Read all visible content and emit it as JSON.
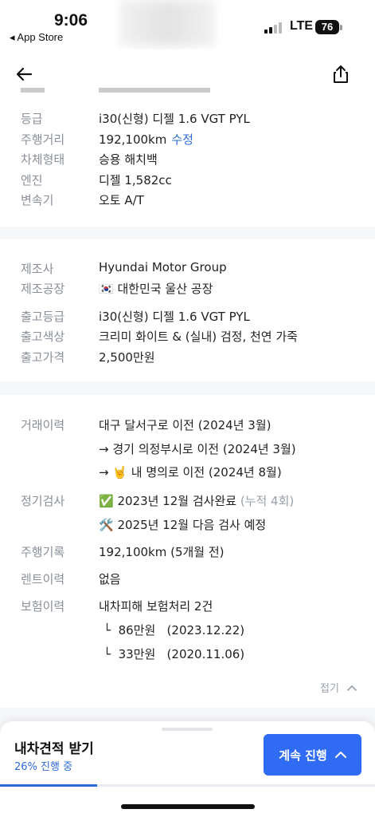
{
  "status_bar": {
    "time": "9:06",
    "back_app": "◂ App Store",
    "network": "LTE",
    "battery": "76"
  },
  "spec": {
    "rows": [
      {
        "label": "등급",
        "value": "i30(신형) 디젤 1.6 VGT PYL"
      },
      {
        "label": "주행거리",
        "value": "192,100km",
        "link": "수정"
      },
      {
        "label": "차체형태",
        "value": "승용 해치백"
      },
      {
        "label": "엔진",
        "value": "디젤 1,582cc"
      },
      {
        "label": "변속기",
        "value": "오토 A/T"
      }
    ]
  },
  "factory": {
    "rows": [
      {
        "label": "제조사",
        "value": "Hyundai Motor Group"
      },
      {
        "label": "제조공장",
        "value": "🇰🇷 대한민국 울산 공장"
      },
      {
        "label": "출고등급",
        "value": "i30(신형) 디젤 1.6 VGT PYL"
      },
      {
        "label": "출고색상",
        "value": "크리미 화이트 & (실내) 검정, 천연 가죽"
      },
      {
        "label": "출고가격",
        "value": "2,500만원"
      }
    ]
  },
  "history": {
    "trade_label": "거래이력",
    "trade_lines": [
      "대구 달서구로 이전 (2024년 3월)",
      "→ 경기 의정부시로 이전 (2024년 3월)",
      "→ 🤘 내 명의로 이전 (2024년 8월)"
    ],
    "inspection_label": "정기검사",
    "inspection_line1": "✅ 2023년 12월 검사완료",
    "inspection_count": "(누적 4회)",
    "inspection_line2": "🛠️ 2025년 12월 다음 검사 예정",
    "mileage_label": "주행기록",
    "mileage_value": "192,100km (5개월 전)",
    "rent_label": "렌트이력",
    "rent_value": "없음",
    "insurance_label": "보험이력",
    "insurance_value": "내차피해 보험처리 2건",
    "insurance_items": [
      "└  86만원   (2023.12.22)",
      "└  33만원   (2020.11.06)"
    ],
    "collapse_label": "접기"
  },
  "bottom_panel": {
    "title": "내차견적 받기",
    "progress_text": "26% 진행 중",
    "progress_value": 0.26,
    "continue_label": "계속 진행"
  },
  "colors": {
    "accent": "#2f6bf3",
    "link": "#2f6bd7"
  }
}
